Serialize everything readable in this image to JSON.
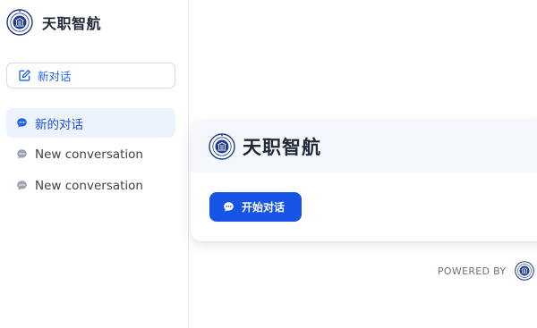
{
  "sidebar": {
    "brand_name": "天职智航",
    "new_chat_label": "新对话",
    "conversations": [
      {
        "label": "新的对话",
        "active": true
      },
      {
        "label": "New conversation",
        "active": false
      },
      {
        "label": "New conversation",
        "active": false
      }
    ]
  },
  "main": {
    "card_title": "天职智航",
    "start_button_label": "开始对话",
    "powered_by": "POWERED BY"
  },
  "colors": {
    "accent": "#1554e5",
    "active_item_bg": "#edf3fc",
    "card_header_bg": "#f4f7fb",
    "logo_navy": "#1e3a8a"
  },
  "icons": {
    "brand_logo": "university-seal-icon",
    "new_chat": "edit-icon",
    "conversation": "chat-bubble-icon",
    "start": "chat-bubble-icon",
    "powered_logo": "university-seal-icon"
  }
}
